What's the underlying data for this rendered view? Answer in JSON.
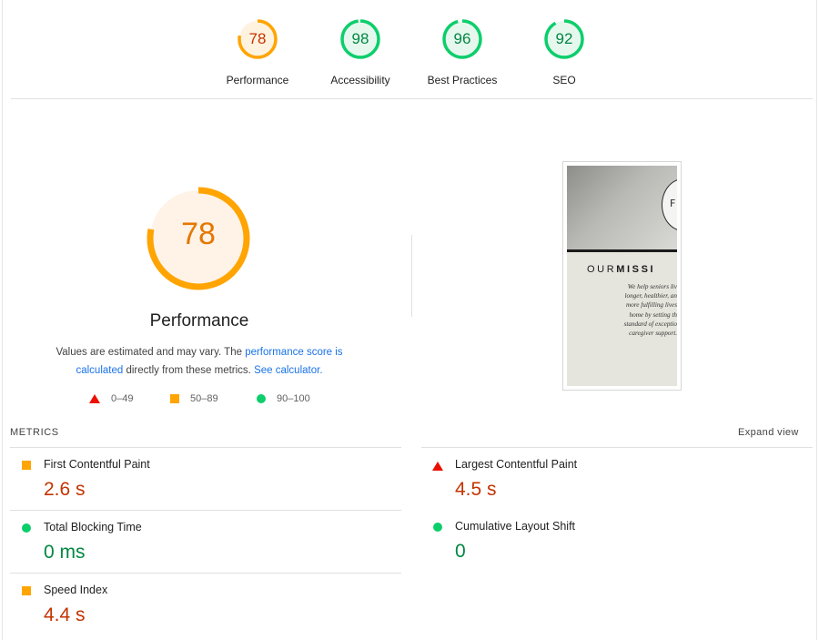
{
  "gauges": [
    {
      "label": "Performance",
      "score": "78",
      "value": 0.78,
      "color": "#ffa400",
      "bg": "#fff3e0",
      "text_color": "#c33300"
    },
    {
      "label": "Accessibility",
      "score": "98",
      "value": 0.98,
      "color": "#0cce6b",
      "bg": "#e6f8ee",
      "text_color": "#018642"
    },
    {
      "label": "Best Practices",
      "score": "96",
      "value": 0.96,
      "color": "#0cce6b",
      "bg": "#e6f8ee",
      "text_color": "#018642"
    },
    {
      "label": "SEO",
      "score": "92",
      "value": 0.92,
      "color": "#0cce6b",
      "bg": "#e6f8ee",
      "text_color": "#018642"
    }
  ],
  "performance": {
    "score": "78",
    "value": 0.78,
    "title": "Performance",
    "desc_part1": "Values are estimated and may vary. The ",
    "desc_link1": "performance score is calculated",
    "desc_part2": " directly from these metrics. ",
    "desc_link2": "See calculator.",
    "colors": {
      "fail": "#eb0f00",
      "average": "#ffa400",
      "pass": "#0cce6b"
    }
  },
  "legend": [
    {
      "shape": "triangle",
      "label": "0–49"
    },
    {
      "shape": "square",
      "label": "50–89"
    },
    {
      "shape": "circle",
      "label": "90–100"
    }
  ],
  "thumbnail": {
    "logo_letter": "F",
    "heading_plain": "OUR",
    "heading_bold": "MISSI",
    "body_text": "We help seniors liv\nlonger, healthier, an\nmore fulfilling lives\nhome by setting th\nstandard of exceptio\ncaregiver support."
  },
  "metrics_header": "METRICS",
  "expand_label": "Expand view",
  "metrics": [
    {
      "name": "First Contentful Paint",
      "value": "2.6 s",
      "status": "average"
    },
    {
      "name": "Largest Contentful Paint",
      "value": "4.5 s",
      "status": "fail"
    },
    {
      "name": "Total Blocking Time",
      "value": "0 ms",
      "status": "pass"
    },
    {
      "name": "Cumulative Layout Shift",
      "value": "0",
      "status": "pass"
    },
    {
      "name": "Speed Index",
      "value": "4.4 s",
      "status": "average"
    }
  ]
}
